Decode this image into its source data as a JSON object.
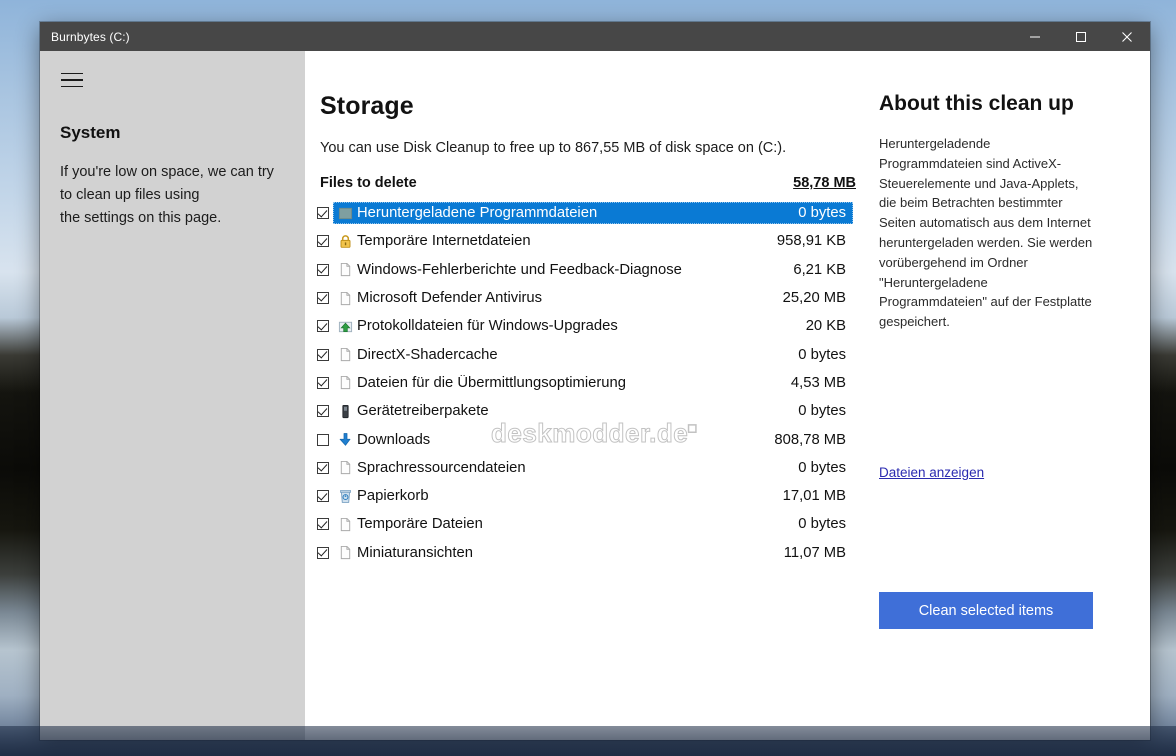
{
  "window": {
    "title": "Burnbytes (C:)",
    "controls": [
      {
        "name": "minimize",
        "label": "─"
      },
      {
        "name": "maximize",
        "label": "□"
      },
      {
        "name": "close",
        "label": "✕"
      }
    ]
  },
  "sidebar": {
    "menu_icon": "hamburger-icon",
    "heading": "System",
    "description": "If you're low on space, we can try\nto clean up files using\nthe settings on this page."
  },
  "main": {
    "title": "Storage",
    "subtitle": "You can use Disk Cleanup to free up to 867,55 MB of disk space on  (C:).",
    "list_header_label": "Files to delete",
    "list_header_total": "58,78 MB",
    "watermark": "deskmodder.de",
    "files": [
      {
        "label": "Heruntergeladene Programmdateien",
        "size": "0 bytes",
        "checked": true,
        "selected": true,
        "icon": "folder-teal-icon"
      },
      {
        "label": "Temporäre Internetdateien",
        "size": "958,91 KB",
        "checked": true,
        "selected": false,
        "icon": "lock-icon"
      },
      {
        "label": "Windows-Fehlerberichte und Feedback-Diagnose",
        "size": "6,21 KB",
        "checked": true,
        "selected": false,
        "icon": "page-icon"
      },
      {
        "label": "Microsoft Defender Antivirus",
        "size": "25,20 MB",
        "checked": true,
        "selected": false,
        "icon": "page-icon"
      },
      {
        "label": "Protokolldateien für Windows-Upgrades",
        "size": "20 KB",
        "checked": true,
        "selected": false,
        "icon": "upgrade-icon"
      },
      {
        "label": "DirectX-Shadercache",
        "size": "0 bytes",
        "checked": true,
        "selected": false,
        "icon": "page-icon"
      },
      {
        "label": "Dateien für die Übermittlungsoptimierung",
        "size": "4,53 MB",
        "checked": true,
        "selected": false,
        "icon": "page-icon"
      },
      {
        "label": "Gerätetreiberpakete",
        "size": "0 bytes",
        "checked": true,
        "selected": false,
        "icon": "device-icon"
      },
      {
        "label": "Downloads",
        "size": "808,78 MB",
        "checked": false,
        "selected": false,
        "icon": "download-arrow-icon"
      },
      {
        "label": "Sprachressourcendateien",
        "size": "0 bytes",
        "checked": true,
        "selected": false,
        "icon": "page-icon"
      },
      {
        "label": "Papierkorb",
        "size": "17,01 MB",
        "checked": true,
        "selected": false,
        "icon": "recycle-bin-icon"
      },
      {
        "label": "Temporäre Dateien",
        "size": "0 bytes",
        "checked": true,
        "selected": false,
        "icon": "page-icon"
      },
      {
        "label": "Miniaturansichten",
        "size": "11,07 MB",
        "checked": true,
        "selected": false,
        "icon": "page-icon"
      }
    ]
  },
  "right_panel": {
    "title": "About this clean up",
    "description": "Heruntergeladende Programmdateien sind ActiveX-Steuerelemente und Java-Applets, die beim Betrachten bestimmter Seiten automatisch aus dem Internet heruntergeladen werden. Sie werden vorübergehend im Ordner \"Heruntergeladene Programmdateien\" auf der Festplatte gespeichert.",
    "view_files_link": "Dateien anzeigen",
    "clean_button": "Clean selected items"
  },
  "colors": {
    "selection_blue": "#0a7ad4",
    "button_blue": "#3f6fd8",
    "link_blue": "#2a2ab0",
    "titlebar": "#474747",
    "sidebar": "#d2d2d2"
  }
}
